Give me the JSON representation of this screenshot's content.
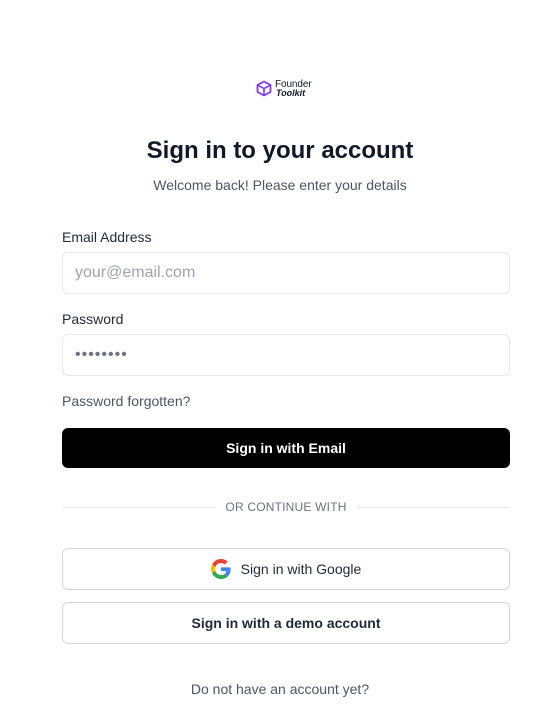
{
  "brand": {
    "name_top": "Founder",
    "name_bottom": "Toolkit",
    "accent_color": "#7c3aed",
    "icon": "cube-logo-icon"
  },
  "heading": {
    "title": "Sign in to your account",
    "subtitle": "Welcome back! Please enter your details"
  },
  "form": {
    "email_label": "Email Address",
    "email_placeholder": "your@email.com",
    "email_value": "",
    "password_label": "Password",
    "password_value": "••••••••",
    "forgot_link": "Password forgotten?",
    "submit_label": "Sign in with Email"
  },
  "divider": {
    "text": "OR CONTINUE WITH"
  },
  "alt_signin": {
    "google_label": "Sign in with Google",
    "google_icon": "google-g-icon",
    "demo_label": "Sign in with a demo account"
  },
  "footer": {
    "signup_prompt": "Do not have an account yet?"
  }
}
